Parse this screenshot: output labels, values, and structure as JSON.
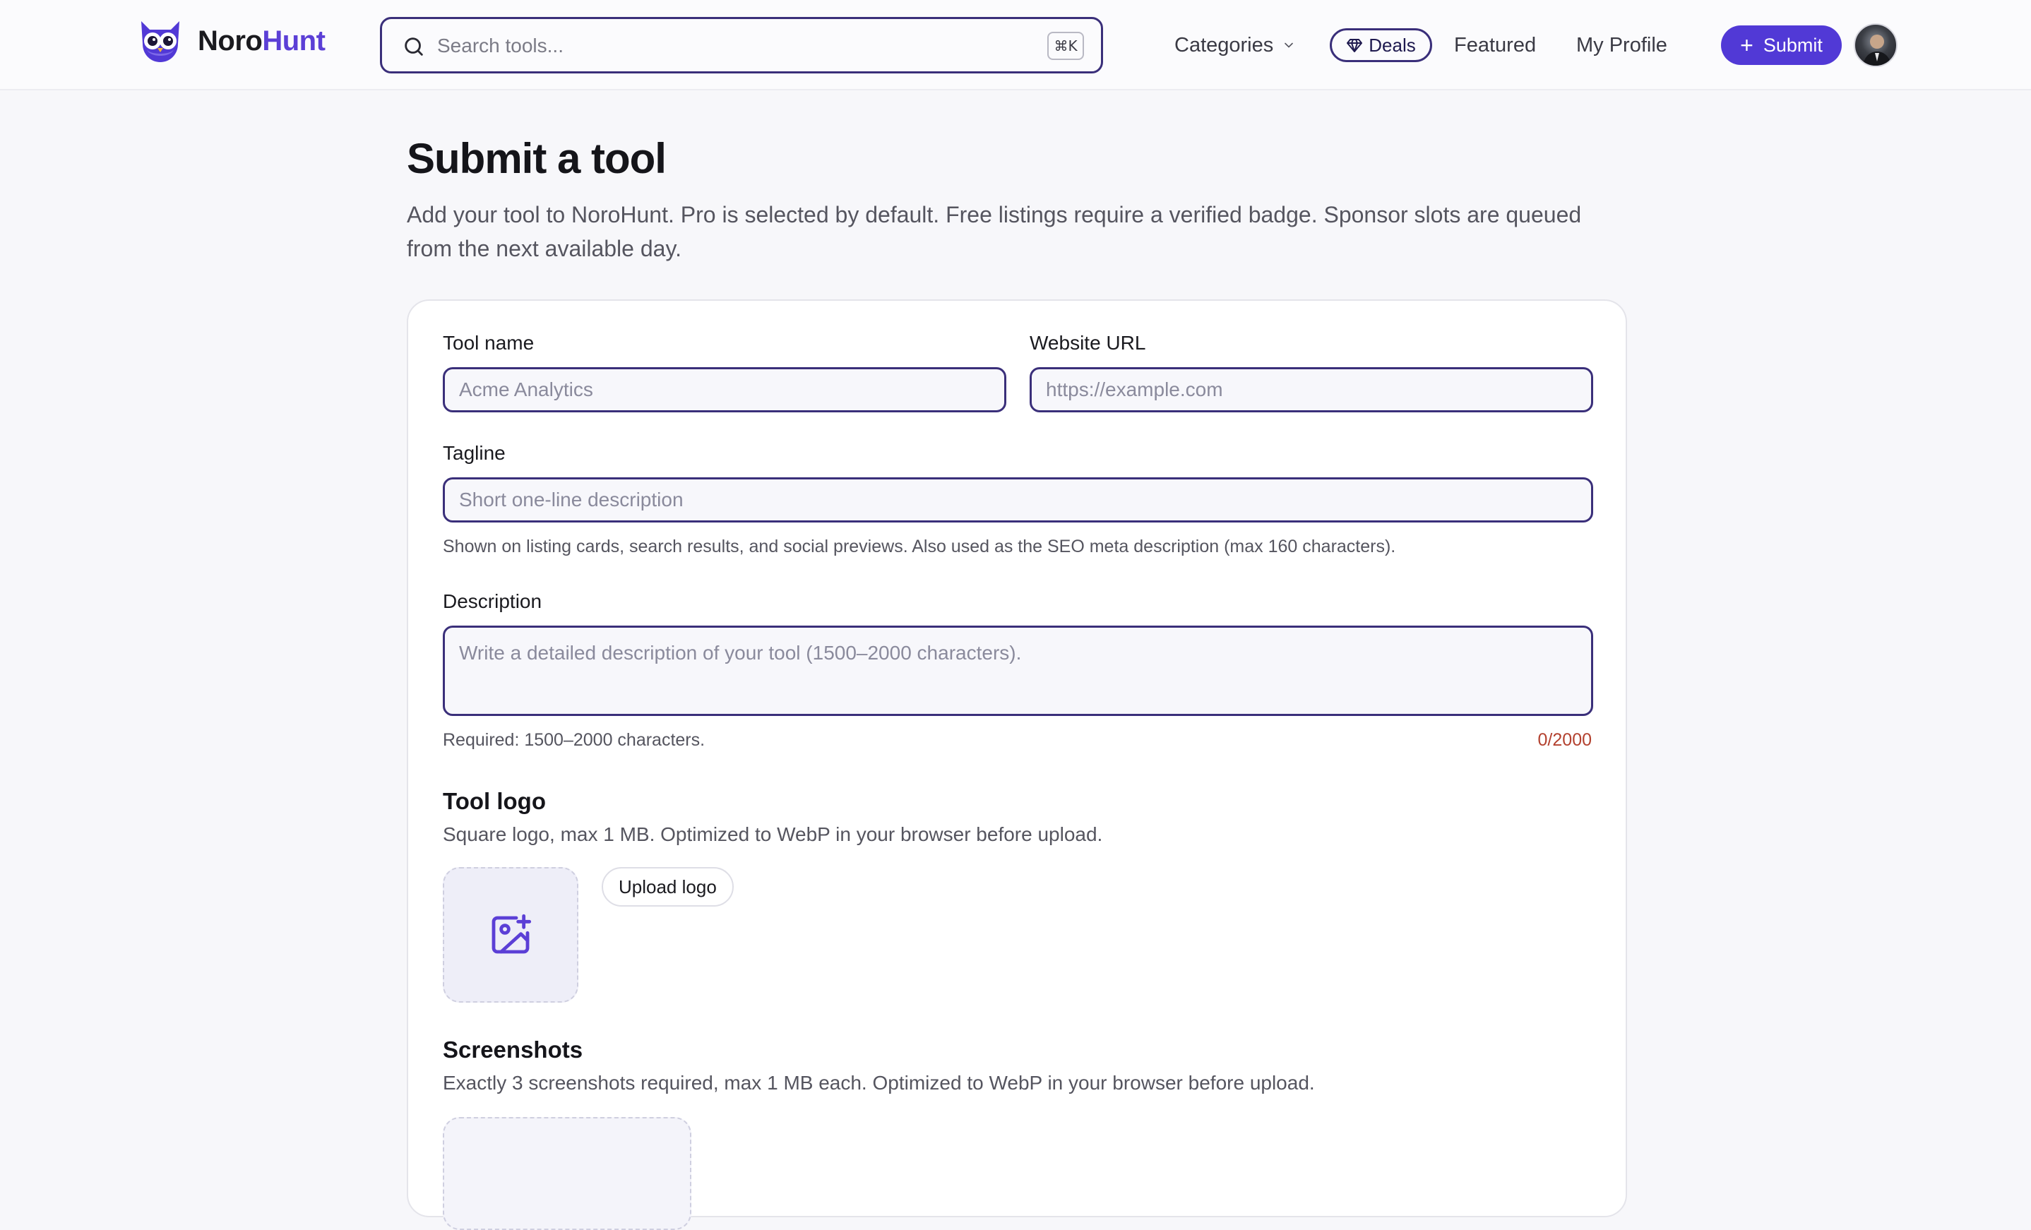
{
  "header": {
    "logo": {
      "text_main": "Noro",
      "text_accent": "Hunt"
    },
    "search": {
      "placeholder": "Search tools...",
      "shortcut": "⌘K"
    },
    "nav": {
      "categories": "Categories",
      "deals": "Deals",
      "featured": "Featured",
      "profile": "My Profile"
    },
    "submit_label": "Submit"
  },
  "page": {
    "title": "Submit a tool",
    "subtitle": "Add your tool to NoroHunt. Pro is selected by default. Free listings require a verified badge. Sponsor slots are queued from the next available day."
  },
  "form": {
    "tool_name": {
      "label": "Tool name",
      "placeholder": "Acme Analytics",
      "value": ""
    },
    "website_url": {
      "label": "Website URL",
      "placeholder": "https://example.com",
      "value": ""
    },
    "tagline": {
      "label": "Tagline",
      "placeholder": "Short one-line description",
      "value": "",
      "help": "Shown on listing cards, search results, and social previews. Also used as the SEO meta description (max 160 characters)."
    },
    "description": {
      "label": "Description",
      "placeholder": "Write a detailed description of your tool (1500–2000 characters).",
      "value": "",
      "help": "Required: 1500–2000 characters.",
      "counter": "0/2000"
    },
    "tool_logo": {
      "title": "Tool logo",
      "subtitle": "Square logo, max 1 MB. Optimized to WebP in your browser before upload.",
      "upload_label": "Upload logo"
    },
    "screenshots": {
      "title": "Screenshots",
      "subtitle": "Exactly 3 screenshots required, max 1 MB each. Optimized to WebP in your browser before upload."
    }
  },
  "icons": {
    "logo": "owl-logo-icon",
    "search": "search-icon",
    "categories": "chevron-down-icon",
    "deals": "diamond-icon",
    "submit": "plus-icon",
    "logo_upload": "image-plus-icon"
  },
  "colors": {
    "accent": "#5139d6",
    "field_border": "#3a2f7a",
    "counter": "#b3412f",
    "background": "#f7f7fa"
  }
}
